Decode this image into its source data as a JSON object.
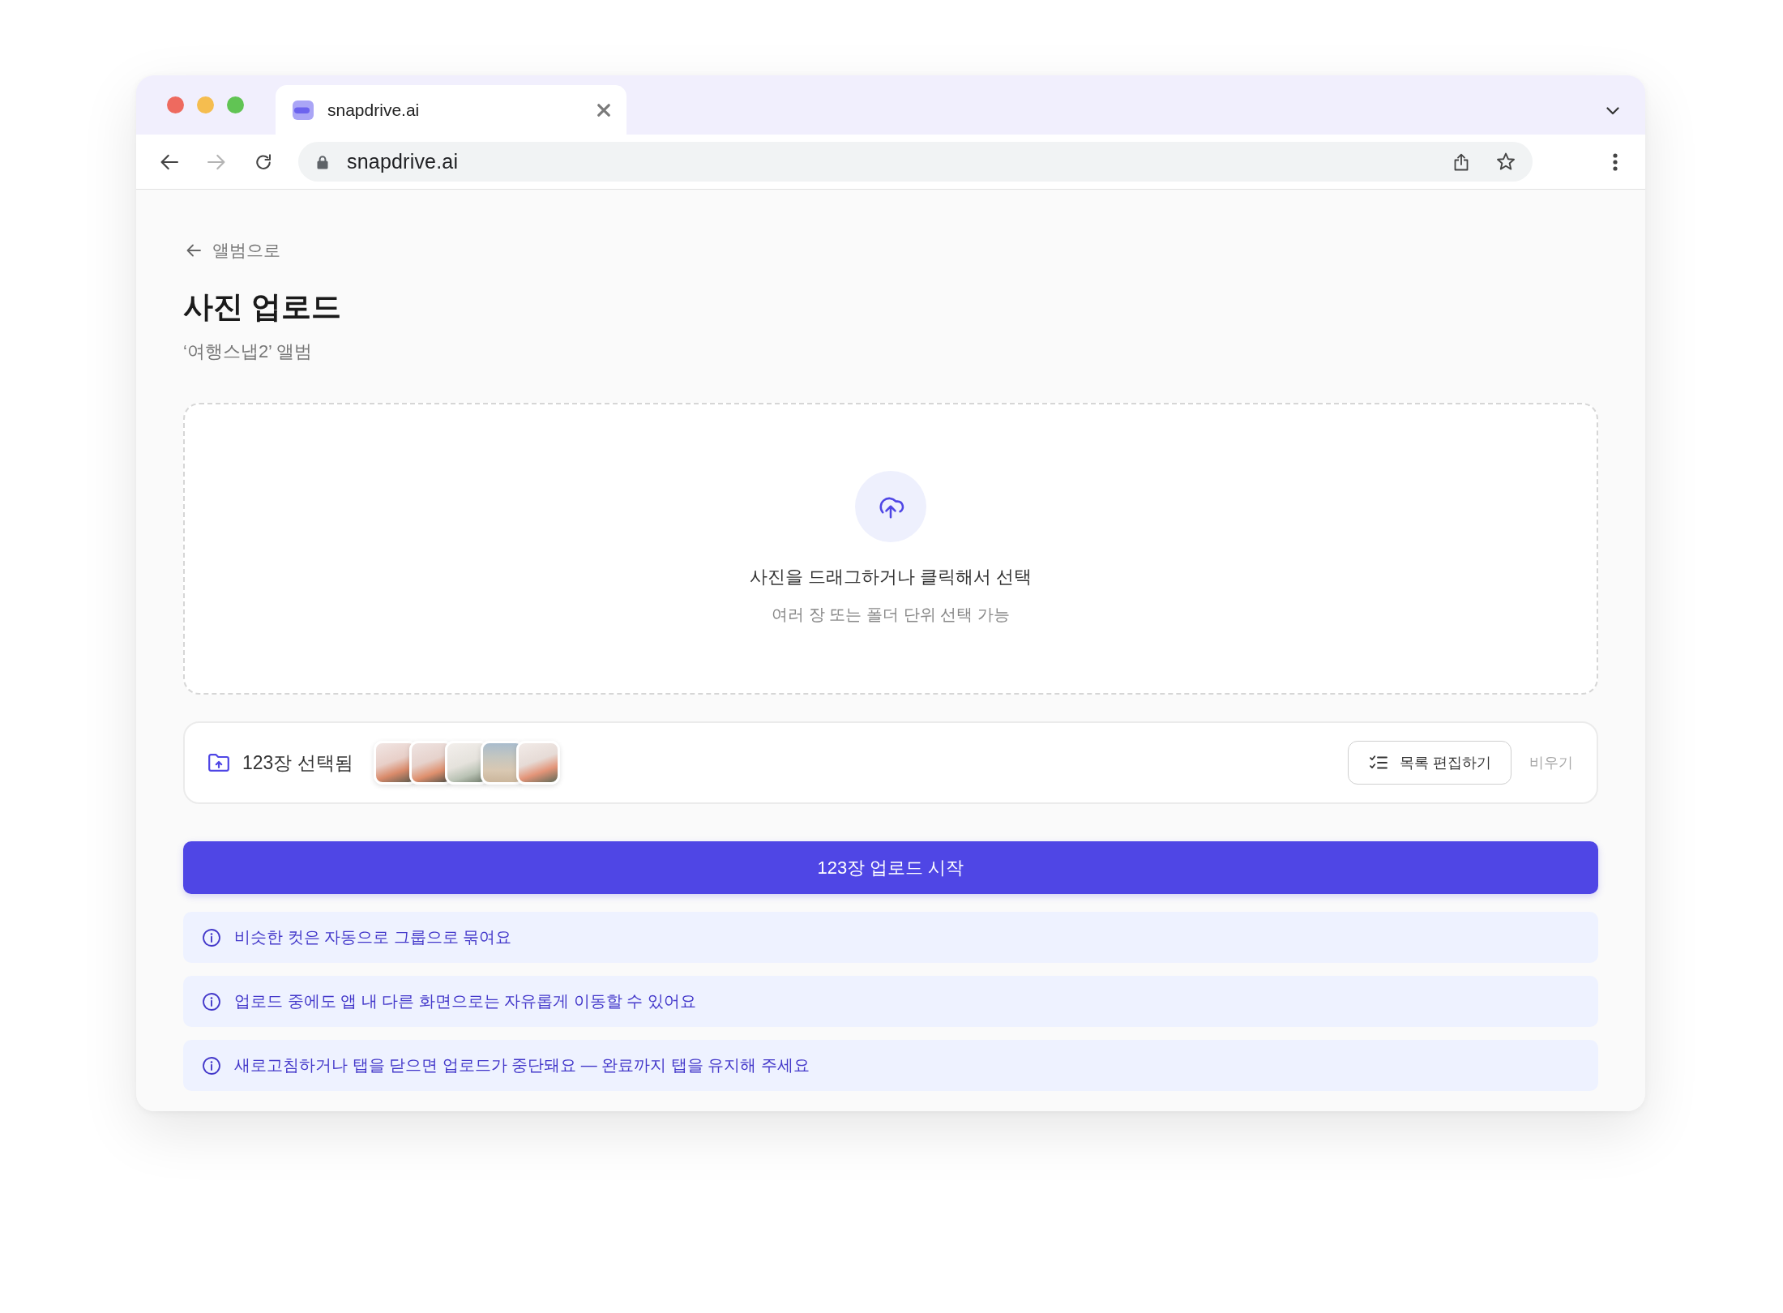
{
  "browser": {
    "tabs": [
      {
        "title": "snapdrive.ai",
        "selected": true
      }
    ],
    "nav_buttons": [
      {
        "kind": "back",
        "disabled": false
      },
      {
        "kind": "forward",
        "disabled": true
      },
      {
        "kind": "reload",
        "disabled": false
      }
    ],
    "address": "snapdrive.ai"
  },
  "page": {
    "back_link": "앨범으로",
    "title": "사진 업로드",
    "subtitle": "‘여행스냅2’ 앨범"
  },
  "dropzone": {
    "title": "사진을 드래그하거나 클릭해서 선택",
    "hint": "여러 장 또는 폴더 단위 선택 가능"
  },
  "selection": {
    "count": "123장 선택됨",
    "edit_button": "목록 편집하기",
    "clear_button": "비우기"
  },
  "upload_button": "123장 업로드 시작",
  "notices": [
    "비슷한 컷은 자동으로 그룹으로 묶여요",
    "업로드 중에도 앱 내 다른 화면으로는 자유롭게 이동할 수 있어요",
    "새로고침하거나 탭을 닫으면 업로드가 중단돼요 — 완료까지 탭을 유지해 주세요"
  ]
}
